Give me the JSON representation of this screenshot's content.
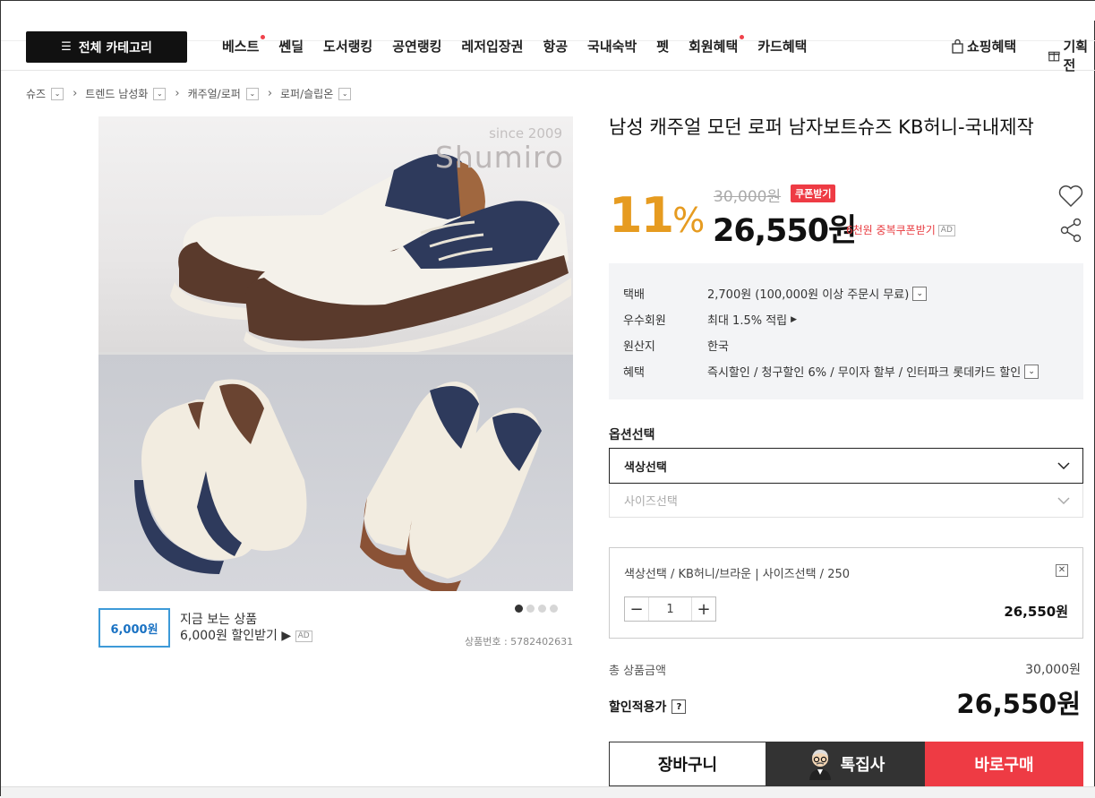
{
  "nav": {
    "all_category": "전체 카테고리",
    "menu": [
      {
        "label": "베스트",
        "dot": true
      },
      {
        "label": "쎈딜",
        "dot": false
      },
      {
        "label": "도서랭킹",
        "dot": false
      },
      {
        "label": "공연랭킹",
        "dot": false
      },
      {
        "label": "레저입장권",
        "dot": false
      },
      {
        "label": "항공",
        "dot": false
      },
      {
        "label": "국내숙박",
        "dot": false
      },
      {
        "label": "펫",
        "dot": false
      },
      {
        "label": "회원혜택",
        "dot": true
      },
      {
        "label": "카드혜택",
        "dot": false
      }
    ],
    "shopping_benefit": "쇼핑혜택",
    "planning": "기획전"
  },
  "breadcrumb": [
    "슈즈",
    "트렌드 남성화",
    "캐주얼/로퍼",
    "로퍼/슬립온"
  ],
  "photo": {
    "since": "since 2009",
    "brand": "Shumiro"
  },
  "coupon_ad": {
    "amount": "6,000원",
    "line1": "지금 보는 상품",
    "line2": "6,000원 할인받기 ▶",
    "ad": "AD"
  },
  "product_no": "상품번호 : 5782402631",
  "product": {
    "title": "남성 캐주얼 모던 로퍼 남자보트슈즈 KB허니-국내제작",
    "discount_rate": "11",
    "discount_unit": "%",
    "original_price": "30,000원",
    "coupon_badge": "쿠폰받기",
    "sale_price": "26,550원",
    "dup_coupon": "6천원 중복쿠폰받기",
    "ad": "AD"
  },
  "info": [
    {
      "key": "택배",
      "value": "2,700원 (100,000원 이상 주문시 무료)"
    },
    {
      "key": "우수회원",
      "value": "최대 1.5% 적립"
    },
    {
      "key": "원산지",
      "value": "한국"
    },
    {
      "key": "혜택",
      "value": "즉시할인 / 청구할인 6% / 무이자 할부 / 인터파크 롯데카드 할인"
    }
  ],
  "options": {
    "label": "옵션선택",
    "color": "색상선택",
    "size": "사이즈선택"
  },
  "selected": {
    "name": "색상선택 / KB허니/브라운 | 사이즈선택 / 250",
    "qty": "1",
    "price": "26,550원"
  },
  "totals": {
    "total_label": "총 상품금액",
    "total_value": "30,000원",
    "discount_label": "할인적용가",
    "discount_value": "26,550원"
  },
  "buttons": {
    "cart": "장바구니",
    "editor": "톡집사",
    "buy": "바로구매"
  },
  "colors": {
    "accent": "#e69b20",
    "red": "#ee3b44",
    "dark": "#333333"
  }
}
